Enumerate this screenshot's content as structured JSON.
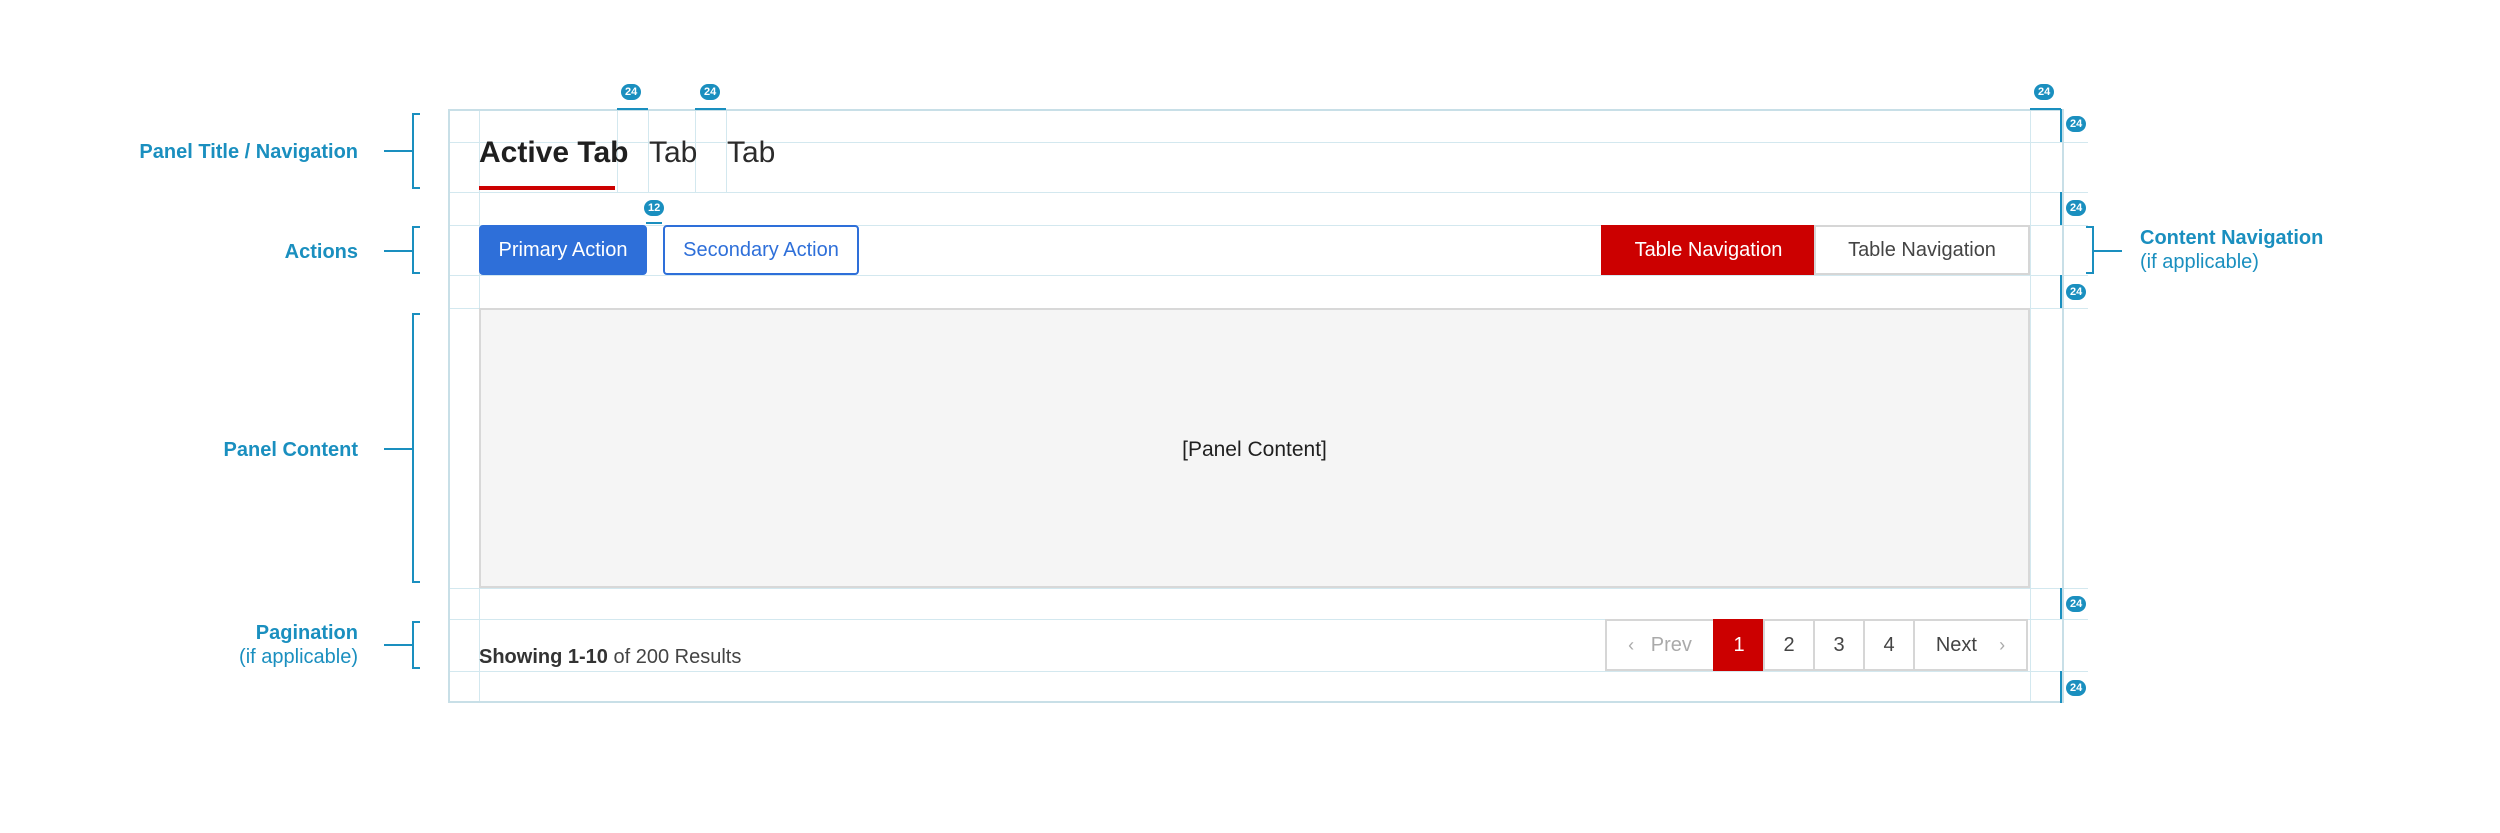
{
  "sections": {
    "panel_title": "Panel Title / Navigation",
    "actions": "Actions",
    "panel_content": "Panel Content",
    "pagination": "Pagination",
    "pagination_sub": "(if applicable)",
    "content_navigation": "Content Navigation",
    "content_navigation_sub": "(if applicable)"
  },
  "tabs": [
    "Active Tab",
    "Tab",
    "Tab"
  ],
  "actions": {
    "primary": "Primary Action",
    "secondary": "Secondary Action"
  },
  "table_navigation": [
    "Table Navigation",
    "Table Navigation"
  ],
  "content": {
    "placeholder": "[Panel Content]"
  },
  "pagination": {
    "summary_bold": "Showing 1-10",
    "summary_rest": "of 200 Results",
    "prev": "Prev",
    "next": "Next",
    "pages": [
      "1",
      "2",
      "3",
      "4"
    ],
    "current": "1"
  },
  "spacing_badges": {
    "tab_gap_1": "24",
    "tab_gap_2": "24",
    "right_padding": "24",
    "title_padding": "24",
    "button_gap": "12",
    "actions_top": "24",
    "actions_bottom": "24",
    "content_bottom": "24",
    "panel_bottom": "24"
  },
  "colors": {
    "annotation": "#1a8fbf",
    "primary": "#2e6fd9",
    "active_red": "#cc0000"
  }
}
